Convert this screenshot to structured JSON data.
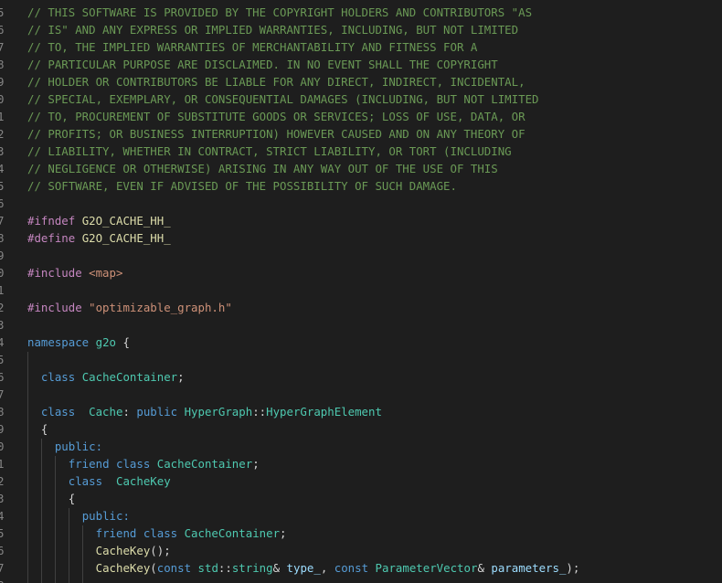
{
  "editor": {
    "line_numbers": [
      "5",
      "6",
      "7",
      "8",
      "9",
      "0",
      "1",
      "2",
      "3",
      "4",
      "5",
      "6",
      "7",
      "8",
      "9",
      "0",
      "1",
      "2",
      "3",
      "4",
      "5",
      "6",
      "7",
      "8",
      "9",
      "0",
      "1",
      "2",
      "3",
      "4",
      "5",
      "6",
      "7",
      "8"
    ],
    "lines": [
      [
        {
          "t": "// THIS SOFTWARE IS PROVIDED BY THE COPYRIGHT HOLDERS AND CONTRIBUTORS \"AS",
          "c": "comment"
        }
      ],
      [
        {
          "t": "// IS\" AND ANY EXPRESS OR IMPLIED WARRANTIES, INCLUDING, BUT NOT LIMITED",
          "c": "comment"
        }
      ],
      [
        {
          "t": "// TO, THE IMPLIED WARRANTIES OF MERCHANTABILITY AND FITNESS FOR A",
          "c": "comment"
        }
      ],
      [
        {
          "t": "// PARTICULAR PURPOSE ARE DISCLAIMED. IN NO EVENT SHALL THE COPYRIGHT",
          "c": "comment"
        }
      ],
      [
        {
          "t": "// HOLDER OR CONTRIBUTORS BE LIABLE FOR ANY DIRECT, INDIRECT, INCIDENTAL,",
          "c": "comment"
        }
      ],
      [
        {
          "t": "// SPECIAL, EXEMPLARY, OR CONSEQUENTIAL DAMAGES (INCLUDING, BUT NOT LIMITED",
          "c": "comment"
        }
      ],
      [
        {
          "t": "// TO, PROCUREMENT OF SUBSTITUTE GOODS OR SERVICES; LOSS OF USE, DATA, OR",
          "c": "comment"
        }
      ],
      [
        {
          "t": "// PROFITS; OR BUSINESS INTERRUPTION) HOWEVER CAUSED AND ON ANY THEORY OF",
          "c": "comment"
        }
      ],
      [
        {
          "t": "// LIABILITY, WHETHER IN CONTRACT, STRICT LIABILITY, OR TORT (INCLUDING",
          "c": "comment"
        }
      ],
      [
        {
          "t": "// NEGLIGENCE OR OTHERWISE) ARISING IN ANY WAY OUT OF THE USE OF THIS",
          "c": "comment"
        }
      ],
      [
        {
          "t": "// SOFTWARE, EVEN IF ADVISED OF THE POSSIBILITY OF SUCH DAMAGE.",
          "c": "comment"
        }
      ],
      [],
      [
        {
          "t": "#ifndef ",
          "c": "preproc"
        },
        {
          "t": "G2O_CACHE_HH_",
          "c": "macro"
        }
      ],
      [
        {
          "t": "#define ",
          "c": "preproc"
        },
        {
          "t": "G2O_CACHE_HH_",
          "c": "macro"
        }
      ],
      [],
      [
        {
          "t": "#include ",
          "c": "preproc"
        },
        {
          "t": "<map>",
          "c": "string"
        }
      ],
      [],
      [
        {
          "t": "#include ",
          "c": "preproc"
        },
        {
          "t": "\"optimizable_graph.h\"",
          "c": "string"
        }
      ],
      [],
      [
        {
          "t": "namespace ",
          "c": "keyword"
        },
        {
          "t": "g2o",
          "c": "type"
        },
        {
          "t": " {",
          "c": "text"
        }
      ],
      [],
      [
        {
          "t": "  ",
          "c": "text"
        },
        {
          "t": "class ",
          "c": "keyword"
        },
        {
          "t": "CacheContainer",
          "c": "type"
        },
        {
          "t": ";",
          "c": "text"
        }
      ],
      [],
      [
        {
          "t": "  ",
          "c": "text"
        },
        {
          "t": "class  ",
          "c": "keyword"
        },
        {
          "t": "Cache",
          "c": "type"
        },
        {
          "t": ": ",
          "c": "text"
        },
        {
          "t": "public ",
          "c": "keyword"
        },
        {
          "t": "HyperGraph",
          "c": "type"
        },
        {
          "t": "::",
          "c": "text"
        },
        {
          "t": "HyperGraphElement",
          "c": "type"
        }
      ],
      [
        {
          "t": "  {",
          "c": "text"
        }
      ],
      [
        {
          "t": "    ",
          "c": "text"
        },
        {
          "t": "public:",
          "c": "keyword"
        }
      ],
      [
        {
          "t": "      ",
          "c": "text"
        },
        {
          "t": "friend ",
          "c": "keyword"
        },
        {
          "t": "class ",
          "c": "keyword"
        },
        {
          "t": "CacheContainer",
          "c": "type"
        },
        {
          "t": ";",
          "c": "text"
        }
      ],
      [
        {
          "t": "      ",
          "c": "text"
        },
        {
          "t": "class  ",
          "c": "keyword"
        },
        {
          "t": "CacheKey",
          "c": "type"
        }
      ],
      [
        {
          "t": "      {",
          "c": "text"
        }
      ],
      [
        {
          "t": "        ",
          "c": "text"
        },
        {
          "t": "public:",
          "c": "keyword"
        }
      ],
      [
        {
          "t": "          ",
          "c": "text"
        },
        {
          "t": "friend ",
          "c": "keyword"
        },
        {
          "t": "class ",
          "c": "keyword"
        },
        {
          "t": "CacheContainer",
          "c": "type"
        },
        {
          "t": ";",
          "c": "text"
        }
      ],
      [
        {
          "t": "          ",
          "c": "text"
        },
        {
          "t": "CacheKey",
          "c": "func"
        },
        {
          "t": "();",
          "c": "text"
        }
      ],
      [
        {
          "t": "          ",
          "c": "text"
        },
        {
          "t": "CacheKey",
          "c": "func"
        },
        {
          "t": "(",
          "c": "text"
        },
        {
          "t": "const ",
          "c": "keyword"
        },
        {
          "t": "std",
          "c": "type"
        },
        {
          "t": "::",
          "c": "text"
        },
        {
          "t": "string",
          "c": "type"
        },
        {
          "t": "& ",
          "c": "text"
        },
        {
          "t": "type_",
          "c": "param"
        },
        {
          "t": ", ",
          "c": "text"
        },
        {
          "t": "const ",
          "c": "keyword"
        },
        {
          "t": "ParameterVector",
          "c": "type"
        },
        {
          "t": "& ",
          "c": "text"
        },
        {
          "t": "parameters_",
          "c": "param"
        },
        {
          "t": ");",
          "c": "text"
        }
      ],
      []
    ]
  }
}
